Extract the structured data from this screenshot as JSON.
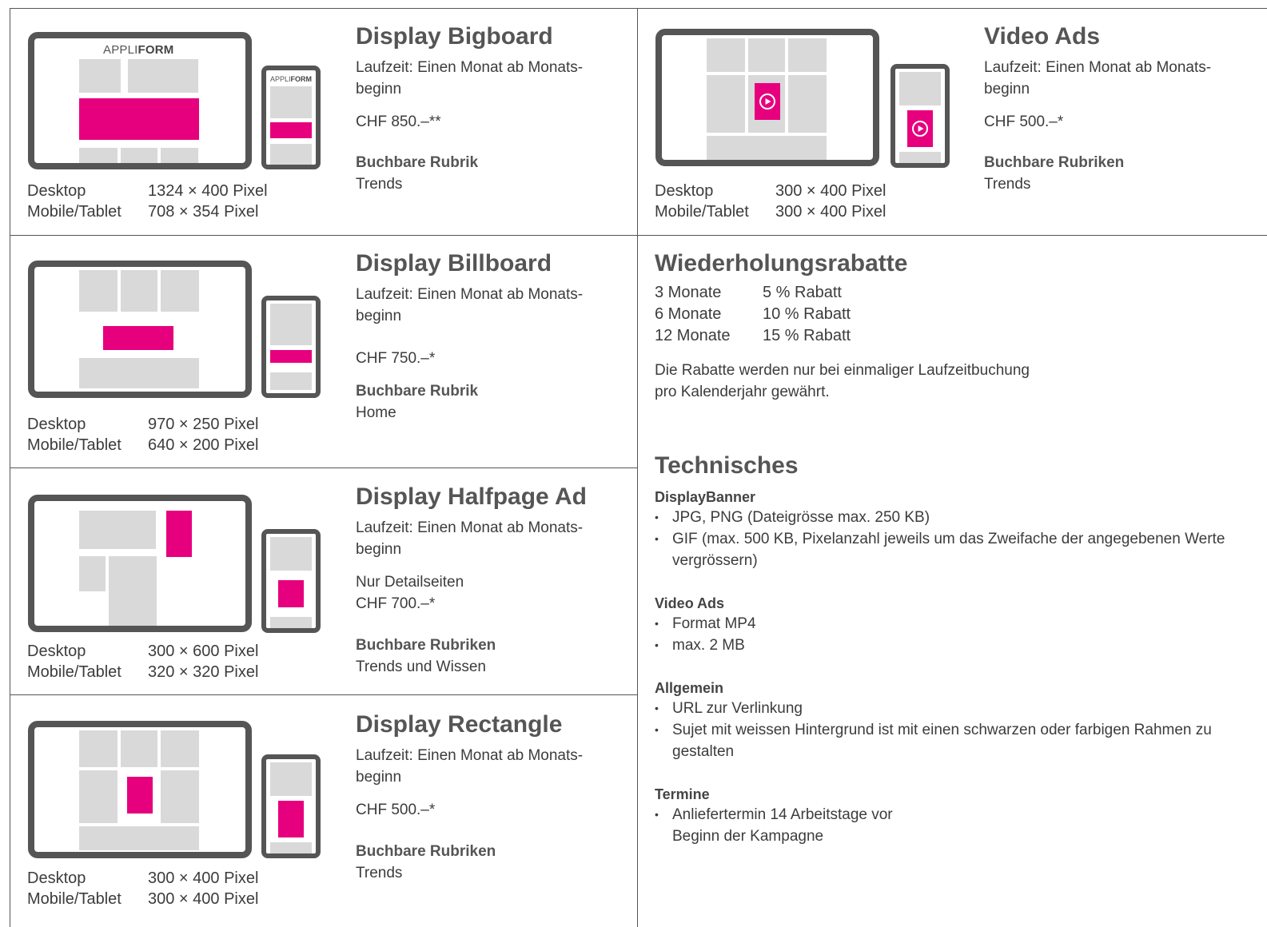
{
  "labels": {
    "desktop": "Desktop",
    "mobile": "Mobile/Tablet"
  },
  "logo": {
    "light": "APPLI",
    "bold": "FORM"
  },
  "products": [
    {
      "title": "Display Bigboard",
      "laufzeit": "Laufzeit: Einen Monat ab Monats-",
      "laufzeit2": "beginn",
      "note": "",
      "price": "CHF 850.–**",
      "rubrik_label": "Buchbare Rubrik",
      "rubrik": "Trends",
      "desktop_size": "1324 × 400 Pixel",
      "mobile_size": "708 × 354 Pixel"
    },
    {
      "title": "Display Billboard",
      "laufzeit": "Laufzeit: Einen Monat ab Monats-",
      "laufzeit2": "beginn",
      "note": "",
      "price": "CHF 750.–*",
      "rubrik_label": "Buchbare Rubrik",
      "rubrik": "Home",
      "desktop_size": "970 × 250 Pixel",
      "mobile_size": "640 × 200 Pixel"
    },
    {
      "title": "Display Halfpage Ad",
      "laufzeit": "Laufzeit: Einen Monat ab Monats-",
      "laufzeit2": "beginn",
      "note": "Nur Detailseiten",
      "price": "CHF 700.–*",
      "rubrik_label": "Buchbare Rubriken",
      "rubrik": "Trends und Wissen",
      "desktop_size": "300 × 600 Pixel",
      "mobile_size": "320 × 320 Pixel"
    },
    {
      "title": "Display Rectangle",
      "laufzeit": "Laufzeit: Einen Monat ab Monats-",
      "laufzeit2": "beginn",
      "note": "",
      "price": "CHF 500.–*",
      "rubrik_label": "Buchbare Rubriken",
      "rubrik": "Trends",
      "desktop_size": "300 × 400 Pixel",
      "mobile_size": "300 × 400 Pixel"
    },
    {
      "title": "Video Ads",
      "laufzeit": "Laufzeit: Einen Monat ab Monats-",
      "laufzeit2": "beginn",
      "note": "",
      "price": "CHF 500.–*",
      "rubrik_label": "Buchbare Rubriken",
      "rubrik": "Trends",
      "desktop_size": "300 × 400 Pixel",
      "mobile_size": "300 × 400 Pixel"
    }
  ],
  "rabatte": {
    "title": "Wiederholungsrabatte",
    "rows": [
      {
        "months": "3 Monate",
        "discount": "5 % Rabatt"
      },
      {
        "months": "6 Monate",
        "discount": "10 % Rabatt"
      },
      {
        "months": "12 Monate",
        "discount": "15 % Rabatt"
      }
    ],
    "note1": "Die Rabatte werden nur bei einmaliger Laufzeitbuchung",
    "note2": "pro Kalenderjahr gewährt."
  },
  "technisches": {
    "title": "Technisches",
    "sections": [
      {
        "heading": "DisplayBanner",
        "items": [
          "JPG, PNG (Dateigrösse max. 250 KB)",
          "GIF (max. 500 KB, Pixelanzahl jeweils um das Zweifache der angegebenen Werte vergrössern)"
        ]
      },
      {
        "heading": "Video Ads",
        "items": [
          "Format MP4",
          "max. 2 MB"
        ]
      },
      {
        "heading": "Allgemein",
        "items": [
          "URL zur Verlinkung",
          "Sujet mit weissen Hintergrund ist mit einen schwarzen oder farbigen Rahmen zu gestalten"
        ]
      },
      {
        "heading": "Termine",
        "items": [
          "Anliefertermin 14 Arbeitstage vor Beginn der Kampagne"
        ]
      }
    ]
  },
  "colors": {
    "accent": "#e6007e",
    "frame": "#555555",
    "placeholder": "#d9d9d9"
  }
}
